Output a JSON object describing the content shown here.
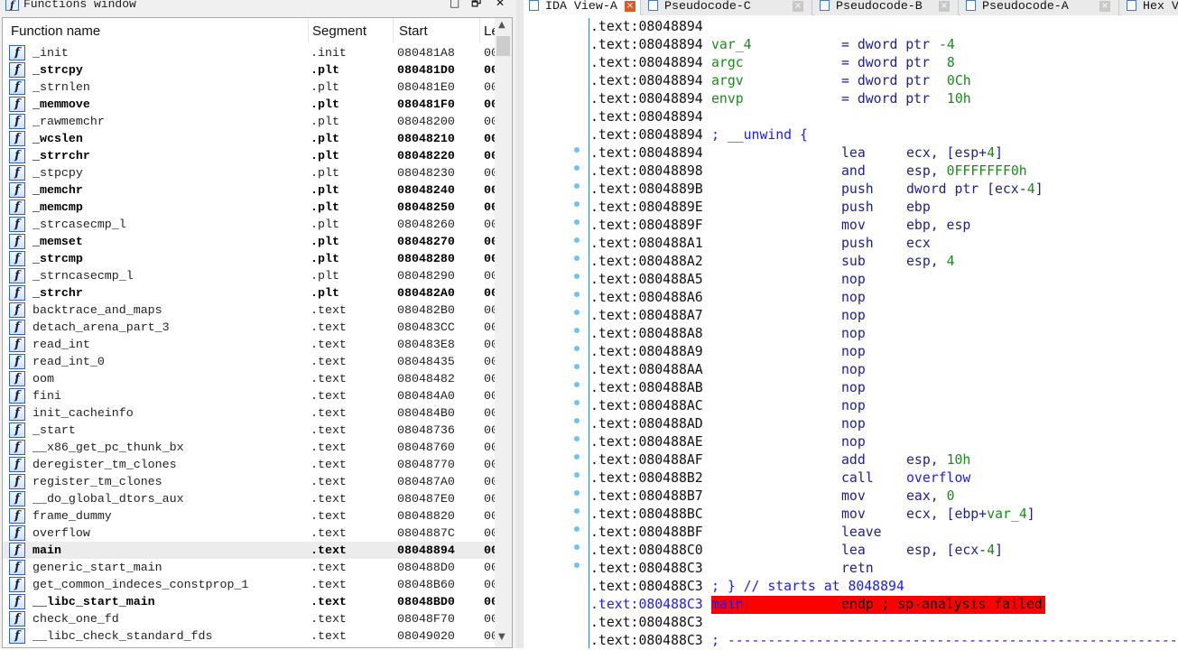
{
  "functions_window": {
    "title": "Functions window",
    "window_buttons": [
      "□",
      "🗗",
      "✕"
    ],
    "columns": [
      "Function name",
      "Segment",
      "Start",
      "Le"
    ],
    "selected_index": 29,
    "rows": [
      {
        "name": "_init",
        "segment": ".init",
        "start": "080481A8",
        "len": "00",
        "bold": false
      },
      {
        "name": "_strcpy",
        "segment": ".plt",
        "start": "080481D0",
        "len": "00",
        "bold": true
      },
      {
        "name": "_strnlen",
        "segment": ".plt",
        "start": "080481E0",
        "len": "00",
        "bold": false
      },
      {
        "name": "_memmove",
        "segment": ".plt",
        "start": "080481F0",
        "len": "00",
        "bold": true
      },
      {
        "name": "_rawmemchr",
        "segment": ".plt",
        "start": "08048200",
        "len": "00",
        "bold": false
      },
      {
        "name": "_wcslen",
        "segment": ".plt",
        "start": "08048210",
        "len": "00",
        "bold": true
      },
      {
        "name": "_strrchr",
        "segment": ".plt",
        "start": "08048220",
        "len": "00",
        "bold": true
      },
      {
        "name": "_stpcpy",
        "segment": ".plt",
        "start": "08048230",
        "len": "00",
        "bold": false
      },
      {
        "name": "_memchr",
        "segment": ".plt",
        "start": "08048240",
        "len": "00",
        "bold": true
      },
      {
        "name": "_memcmp",
        "segment": ".plt",
        "start": "08048250",
        "len": "00",
        "bold": true
      },
      {
        "name": "_strcasecmp_l",
        "segment": ".plt",
        "start": "08048260",
        "len": "00",
        "bold": false
      },
      {
        "name": "_memset",
        "segment": ".plt",
        "start": "08048270",
        "len": "00",
        "bold": true
      },
      {
        "name": "_strcmp",
        "segment": ".plt",
        "start": "08048280",
        "len": "00",
        "bold": true
      },
      {
        "name": "_strncasecmp_l",
        "segment": ".plt",
        "start": "08048290",
        "len": "00",
        "bold": false
      },
      {
        "name": "_strchr",
        "segment": ".plt",
        "start": "080482A0",
        "len": "00",
        "bold": true
      },
      {
        "name": "backtrace_and_maps",
        "segment": ".text",
        "start": "080482B0",
        "len": "00",
        "bold": false
      },
      {
        "name": "detach_arena_part_3",
        "segment": ".text",
        "start": "080483CC",
        "len": "00",
        "bold": false
      },
      {
        "name": "read_int",
        "segment": ".text",
        "start": "080483E8",
        "len": "00",
        "bold": false
      },
      {
        "name": "read_int_0",
        "segment": ".text",
        "start": "08048435",
        "len": "00",
        "bold": false
      },
      {
        "name": "oom",
        "segment": ".text",
        "start": "08048482",
        "len": "00",
        "bold": false
      },
      {
        "name": "fini",
        "segment": ".text",
        "start": "080484A0",
        "len": "00",
        "bold": false
      },
      {
        "name": "init_cacheinfo",
        "segment": ".text",
        "start": "080484B0",
        "len": "00",
        "bold": false
      },
      {
        "name": "_start",
        "segment": ".text",
        "start": "08048736",
        "len": "00",
        "bold": false
      },
      {
        "name": "__x86_get_pc_thunk_bx",
        "segment": ".text",
        "start": "08048760",
        "len": "00",
        "bold": false
      },
      {
        "name": "deregister_tm_clones",
        "segment": ".text",
        "start": "08048770",
        "len": "00",
        "bold": false
      },
      {
        "name": "register_tm_clones",
        "segment": ".text",
        "start": "080487A0",
        "len": "00",
        "bold": false
      },
      {
        "name": "__do_global_dtors_aux",
        "segment": ".text",
        "start": "080487E0",
        "len": "00",
        "bold": false
      },
      {
        "name": "frame_dummy",
        "segment": ".text",
        "start": "08048820",
        "len": "00",
        "bold": false
      },
      {
        "name": "overflow",
        "segment": ".text",
        "start": "0804887C",
        "len": "00",
        "bold": false
      },
      {
        "name": "main",
        "segment": ".text",
        "start": "08048894",
        "len": "00",
        "bold": true
      },
      {
        "name": "generic_start_main",
        "segment": ".text",
        "start": "080488D0",
        "len": "00",
        "bold": false
      },
      {
        "name": "get_common_indeces_constprop_1",
        "segment": ".text",
        "start": "08048B60",
        "len": "00",
        "bold": false
      },
      {
        "name": "__libc_start_main",
        "segment": ".text",
        "start": "08048BD0",
        "len": "00",
        "bold": true
      },
      {
        "name": "check_one_fd",
        "segment": ".text",
        "start": "08048F70",
        "len": "00",
        "bold": false
      },
      {
        "name": "__libc_check_standard_fds",
        "segment": ".text",
        "start": "08049020",
        "len": "00",
        "bold": false
      }
    ]
  },
  "tabs": [
    {
      "label": "IDA View-A",
      "active": true
    },
    {
      "label": "Pseudocode-C",
      "active": false
    },
    {
      "label": "Pseudocode-B",
      "active": false
    },
    {
      "label": "Pseudocode-A",
      "active": false
    },
    {
      "label": "Hex V",
      "active": false
    }
  ],
  "colors": {
    "highlight": "#ff0000",
    "label": "#1a8a1a",
    "mnemonic": "#202090",
    "comment": "#1a1aff",
    "breakpoint_dot": "#6ec3ee"
  },
  "listing": [
    {
      "addr": ".text:08048894"
    },
    {
      "addr": ".text:08048894",
      "label": "var_4",
      "mnem": "= dword ptr",
      "ops": [
        [
          "-4",
          "num"
        ]
      ],
      "equ": true
    },
    {
      "addr": ".text:08048894",
      "label": "argc",
      "mnem": "= dword ptr",
      "ops": [
        [
          " 8",
          "num"
        ]
      ],
      "equ": true
    },
    {
      "addr": ".text:08048894",
      "label": "argv",
      "mnem": "= dword ptr",
      "ops": [
        [
          " 0Ch",
          "num"
        ]
      ],
      "equ": true
    },
    {
      "addr": ".text:08048894",
      "label": "envp",
      "mnem": "= dword ptr",
      "ops": [
        [
          " 10h",
          "num"
        ]
      ],
      "equ": true
    },
    {
      "addr": ".text:08048894"
    },
    {
      "addr": ".text:08048894",
      "comment": "; __unwind {"
    },
    {
      "addr": ".text:08048894",
      "mnem": "lea",
      "ops": [
        [
          "ecx, [esp+",
          "k"
        ],
        [
          "4",
          "num"
        ],
        [
          "]",
          "k"
        ]
      ],
      "dot": true
    },
    {
      "addr": ".text:08048898",
      "mnem": "and",
      "ops": [
        [
          "esp, ",
          "k"
        ],
        [
          "0FFFFFFF0h",
          "num"
        ]
      ],
      "dot": true
    },
    {
      "addr": ".text:0804889B",
      "mnem": "push",
      "ops": [
        [
          "dword ptr [ecx-",
          "k"
        ],
        [
          "4",
          "num"
        ],
        [
          "]",
          "k"
        ]
      ],
      "dot": true
    },
    {
      "addr": ".text:0804889E",
      "mnem": "push",
      "ops": [
        [
          "ebp",
          "k"
        ]
      ],
      "dot": true
    },
    {
      "addr": ".text:0804889F",
      "mnem": "mov",
      "ops": [
        [
          "ebp, esp",
          "k"
        ]
      ],
      "dot": true
    },
    {
      "addr": ".text:080488A1",
      "mnem": "push",
      "ops": [
        [
          "ecx",
          "k"
        ]
      ],
      "dot": true
    },
    {
      "addr": ".text:080488A2",
      "mnem": "sub",
      "ops": [
        [
          "esp, ",
          "k"
        ],
        [
          "4",
          "num"
        ]
      ],
      "dot": true
    },
    {
      "addr": ".text:080488A5",
      "mnem": "nop",
      "dot": true
    },
    {
      "addr": ".text:080488A6",
      "mnem": "nop",
      "dot": true
    },
    {
      "addr": ".text:080488A7",
      "mnem": "nop",
      "dot": true
    },
    {
      "addr": ".text:080488A8",
      "mnem": "nop",
      "dot": true
    },
    {
      "addr": ".text:080488A9",
      "mnem": "nop",
      "dot": true
    },
    {
      "addr": ".text:080488AA",
      "mnem": "nop",
      "dot": true
    },
    {
      "addr": ".text:080488AB",
      "mnem": "nop",
      "dot": true
    },
    {
      "addr": ".text:080488AC",
      "mnem": "nop",
      "dot": true
    },
    {
      "addr": ".text:080488AD",
      "mnem": "nop",
      "dot": true
    },
    {
      "addr": ".text:080488AE",
      "mnem": "nop",
      "dot": true
    },
    {
      "addr": ".text:080488AF",
      "mnem": "add",
      "ops": [
        [
          "esp, ",
          "k"
        ],
        [
          "10h",
          "num"
        ]
      ],
      "dot": true
    },
    {
      "addr": ".text:080488B2",
      "mnem": "call",
      "ops": [
        [
          "overflow",
          "bl"
        ]
      ],
      "dot": true
    },
    {
      "addr": ".text:080488B7",
      "mnem": "mov",
      "ops": [
        [
          "eax, ",
          "k"
        ],
        [
          "0",
          "num"
        ]
      ],
      "dot": true
    },
    {
      "addr": ".text:080488BC",
      "mnem": "mov",
      "ops": [
        [
          "ecx, [ebp+",
          "k"
        ],
        [
          "var_4",
          "g"
        ],
        [
          "]",
          "k"
        ]
      ],
      "dot": true
    },
    {
      "addr": ".text:080488BF",
      "mnem": "leave",
      "dot": true
    },
    {
      "addr": ".text:080488C0",
      "mnem": "lea",
      "ops": [
        [
          "esp, [ecx-",
          "k"
        ],
        [
          "4",
          "num"
        ],
        [
          "]",
          "k"
        ]
      ],
      "dot": true
    },
    {
      "addr": ".text:080488C3",
      "mnem": "retn",
      "dot": true
    },
    {
      "addr": ".text:080488C3",
      "comment": "; } // starts at 8048894"
    },
    {
      "addr": ".text:080488C3",
      "label": "main",
      "mnem": "endp ; sp-analysis failed",
      "highlight": true
    },
    {
      "addr": ".text:080488C3"
    },
    {
      "addr": ".text:080488C3",
      "comment": "; ------------------------------------------------------------"
    }
  ]
}
